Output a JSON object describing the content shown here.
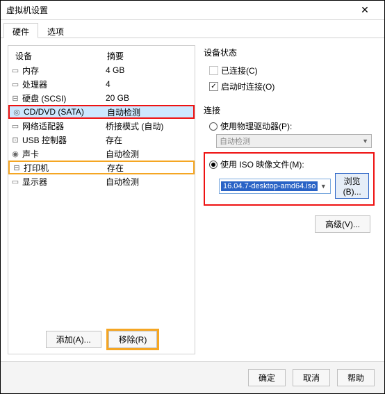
{
  "window": {
    "title": "虚拟机设置"
  },
  "tabs": {
    "hardware": "硬件",
    "options": "选项"
  },
  "hw": {
    "headers": {
      "device": "设备",
      "summary": "摘要"
    },
    "rows": [
      {
        "icon": "▭",
        "name": "内存",
        "summary": "4 GB"
      },
      {
        "icon": "▭",
        "name": "处理器",
        "summary": "4"
      },
      {
        "icon": "⊟",
        "name": "硬盘 (SCSI)",
        "summary": "20 GB"
      },
      {
        "icon": "◎",
        "name": "CD/DVD (SATA)",
        "summary": "自动检测"
      },
      {
        "icon": "▭",
        "name": "网络适配器",
        "summary": "桥接模式 (自动)"
      },
      {
        "icon": "⊡",
        "name": "USB 控制器",
        "summary": "存在"
      },
      {
        "icon": "◉",
        "name": "声卡",
        "summary": "自动检测"
      },
      {
        "icon": "⊟",
        "name": "打印机",
        "summary": "存在"
      },
      {
        "icon": "▭",
        "name": "显示器",
        "summary": "自动检测"
      }
    ]
  },
  "buttons": {
    "add": "添加(A)...",
    "remove": "移除(R)"
  },
  "right": {
    "status_title": "设备状态",
    "connected": "已连接(C)",
    "connect_at_power_on": "启动时连接(O)",
    "connection_title": "连接",
    "use_physical": "使用物理驱动器(P):",
    "auto_detect": "自动检测",
    "use_iso": "使用 ISO 映像文件(M):",
    "iso_value": "16.04.7-desktop-amd64.iso",
    "browse": "浏览(B)...",
    "advanced": "高级(V)..."
  },
  "footer": {
    "ok": "确定",
    "cancel": "取消",
    "help": "帮助"
  }
}
